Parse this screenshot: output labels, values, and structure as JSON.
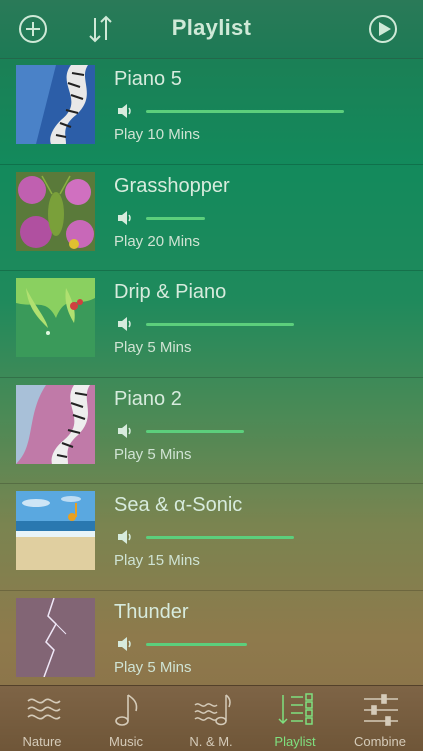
{
  "header": {
    "title": "Playlist",
    "left_icons": [
      "add-circle-icon",
      "sort-icon"
    ],
    "right_icon": "play-circle-icon"
  },
  "playlist": [
    {
      "name": "Piano 5",
      "duration": "Play 10 Mins",
      "volume": 0.81,
      "thumb": "piano-blue"
    },
    {
      "name": "Grasshopper",
      "duration": "Play 20 Mins",
      "volume": 0.24,
      "thumb": "grasshopper-flowers"
    },
    {
      "name": "Drip & Piano",
      "duration": "Play 5 Mins",
      "volume": 0.6,
      "thumb": "leaf-drip"
    },
    {
      "name": "Piano 2",
      "duration": "Play 5 Mins",
      "volume": 0.4,
      "thumb": "piano-pink"
    },
    {
      "name": "Sea & α-Sonic",
      "duration": "Play 15 Mins",
      "volume": 0.6,
      "thumb": "sea-beach"
    },
    {
      "name": "Thunder",
      "duration": "Play 5 Mins",
      "volume": 0.41,
      "thumb": "lightning"
    }
  ],
  "tabs": [
    {
      "label": "Nature",
      "icon": "waves-icon",
      "active": false
    },
    {
      "label": "Music",
      "icon": "music-note-icon",
      "active": false
    },
    {
      "label": "N. & M.",
      "icon": "waves-note-icon",
      "active": false
    },
    {
      "label": "Playlist",
      "icon": "playlist-icon",
      "active": true
    },
    {
      "label": "Combine",
      "icon": "sliders-icon",
      "active": false
    }
  ],
  "colors": {
    "accent": "#5ccf7c",
    "active_tab": "#7fe07f",
    "text": "#d7ebdd"
  }
}
